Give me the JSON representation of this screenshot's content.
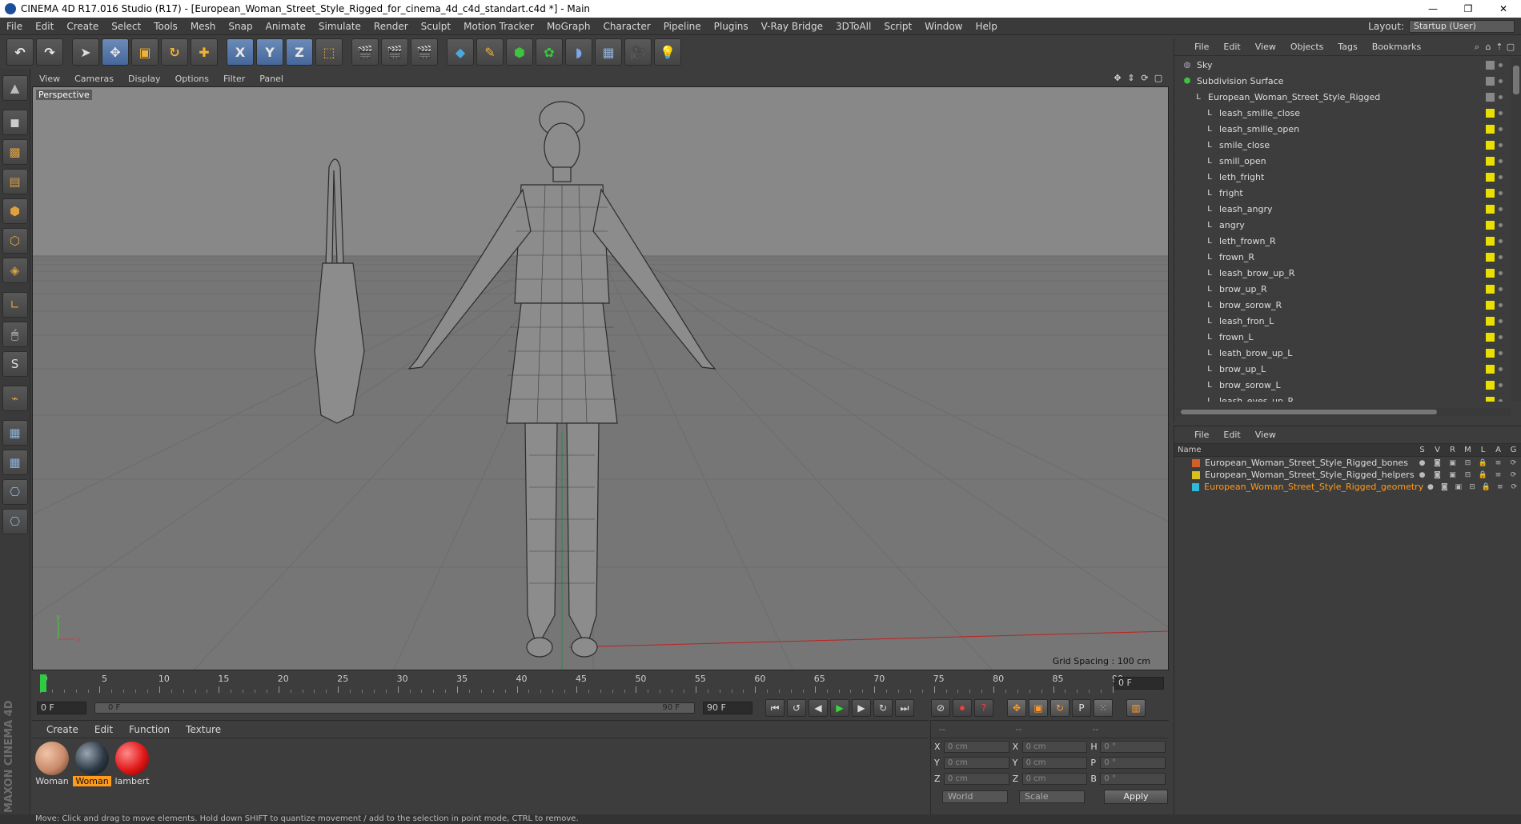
{
  "window": {
    "title": "CINEMA 4D R17.016 Studio (R17) - [European_Woman_Street_Style_Rigged_for_cinema_4d_c4d_standart.c4d *] - Main",
    "minimize": "—",
    "restore": "❐",
    "close": "✕"
  },
  "menubar": {
    "items": [
      "File",
      "Edit",
      "Create",
      "Select",
      "Tools",
      "Mesh",
      "Snap",
      "Animate",
      "Simulate",
      "Render",
      "Sculpt",
      "Motion Tracker",
      "MoGraph",
      "Character",
      "Pipeline",
      "Plugins",
      "V-Ray Bridge",
      "3DToAll",
      "Script",
      "Window",
      "Help"
    ],
    "layout_label": "Layout:",
    "layout_value": "Startup (User)"
  },
  "toolbar": {
    "undo": "↶",
    "redo": "↷",
    "move": "✥",
    "scale": "▣",
    "rotate": "↻",
    "axis_x": "X",
    "axis_y": "Y",
    "axis_z": "Z"
  },
  "viewport": {
    "menu": [
      "View",
      "Cameras",
      "Display",
      "Options",
      "Filter",
      "Panel"
    ],
    "label": "Perspective",
    "grid_spacing": "Grid Spacing : 100 cm"
  },
  "timeline": {
    "ticks": [
      "0",
      "5",
      "10",
      "15",
      "20",
      "25",
      "30",
      "35",
      "40",
      "45",
      "50",
      "55",
      "60",
      "65",
      "70",
      "75",
      "80",
      "85",
      "90"
    ],
    "current_frame": "0 F"
  },
  "transport": {
    "start_field": "0 F",
    "range_start": "0 F",
    "range_end": "90 F",
    "end_field": "90 F"
  },
  "materials": {
    "menu": [
      "Create",
      "Edit",
      "Function",
      "Texture"
    ],
    "items": [
      {
        "label": "Woman",
        "selected": false,
        "color": "#c98b6b"
      },
      {
        "label": "Woman",
        "selected": true,
        "color": "#2d3a46"
      },
      {
        "label": "lambert",
        "selected": false,
        "color": "#e01818"
      }
    ]
  },
  "coordinates": {
    "headers": [
      "--",
      "--",
      "--"
    ],
    "rows": [
      {
        "a": "X",
        "av": "0 cm",
        "b": "X",
        "bv": "0 cm",
        "c": "H",
        "cv": "0 °"
      },
      {
        "a": "Y",
        "av": "0 cm",
        "b": "Y",
        "bv": "0 cm",
        "c": "P",
        "cv": "0 °"
      },
      {
        "a": "Z",
        "av": "0 cm",
        "b": "Z",
        "bv": "0 cm",
        "c": "B",
        "cv": "0 °"
      }
    ],
    "mode": "World",
    "type": "Scale",
    "apply": "Apply"
  },
  "object_manager": {
    "menu": [
      "File",
      "Edit",
      "View",
      "Objects",
      "Tags",
      "Bookmarks"
    ],
    "items": [
      {
        "name": "Sky",
        "indent": 0,
        "icon": "sky-icon",
        "tag": "#888888"
      },
      {
        "name": "Subdivision Surface",
        "indent": 0,
        "icon": "subdivision-icon",
        "tag": "#888888"
      },
      {
        "name": "European_Woman_Street_Style_Rigged",
        "indent": 1,
        "icon": "null-icon",
        "tag": "#888888"
      },
      {
        "name": "leash_smille_close",
        "indent": 2,
        "icon": "null-icon",
        "tag": "#e8e000"
      },
      {
        "name": "leash_smille_open",
        "indent": 2,
        "icon": "null-icon",
        "tag": "#e8e000"
      },
      {
        "name": "smile_close",
        "indent": 2,
        "icon": "null-icon",
        "tag": "#e8e000"
      },
      {
        "name": "smill_open",
        "indent": 2,
        "icon": "null-icon",
        "tag": "#e8e000"
      },
      {
        "name": "leth_fright",
        "indent": 2,
        "icon": "null-icon",
        "tag": "#e8e000"
      },
      {
        "name": "fright",
        "indent": 2,
        "icon": "null-icon",
        "tag": "#e8e000"
      },
      {
        "name": "leash_angry",
        "indent": 2,
        "icon": "null-icon",
        "tag": "#e8e000"
      },
      {
        "name": "angry",
        "indent": 2,
        "icon": "null-icon",
        "tag": "#e8e000"
      },
      {
        "name": "leth_frown_R",
        "indent": 2,
        "icon": "null-icon",
        "tag": "#e8e000"
      },
      {
        "name": "frown_R",
        "indent": 2,
        "icon": "null-icon",
        "tag": "#e8e000"
      },
      {
        "name": "leash_brow_up_R",
        "indent": 2,
        "icon": "null-icon",
        "tag": "#e8e000"
      },
      {
        "name": "brow_up_R",
        "indent": 2,
        "icon": "null-icon",
        "tag": "#e8e000"
      },
      {
        "name": "brow_sorow_R",
        "indent": 2,
        "icon": "null-icon",
        "tag": "#e8e000"
      },
      {
        "name": "leash_fron_L",
        "indent": 2,
        "icon": "null-icon",
        "tag": "#e8e000"
      },
      {
        "name": "frown_L",
        "indent": 2,
        "icon": "null-icon",
        "tag": "#e8e000"
      },
      {
        "name": "leath_brow_up_L",
        "indent": 2,
        "icon": "null-icon",
        "tag": "#e8e000"
      },
      {
        "name": "brow_up_L",
        "indent": 2,
        "icon": "null-icon",
        "tag": "#e8e000"
      },
      {
        "name": "brow_sorow_L",
        "indent": 2,
        "icon": "null-icon",
        "tag": "#e8e000"
      },
      {
        "name": "leash_eyes_up_R",
        "indent": 2,
        "icon": "null-icon",
        "tag": "#e8e000"
      }
    ]
  },
  "layer_manager": {
    "menu": [
      "File",
      "Edit",
      "View"
    ],
    "col_name": "Name",
    "cols": [
      "S",
      "V",
      "R",
      "M",
      "L",
      "A",
      "G"
    ],
    "layers": [
      {
        "name": "European_Woman_Street_Style_Rigged_bones",
        "color": "#d0602a",
        "active": false
      },
      {
        "name": "European_Woman_Street_Style_Rigged_helpers",
        "color": "#d8c020",
        "active": false
      },
      {
        "name": "European_Woman_Street_Style_Rigged_geometry",
        "color": "#30b8d8",
        "active": true
      }
    ]
  },
  "status": {
    "text": "Move: Click and drag to move elements. Hold down SHIFT to quantize movement / add to the selection in point mode, CTRL to remove."
  },
  "branding": {
    "logo": "MAXON CINEMA 4D"
  }
}
